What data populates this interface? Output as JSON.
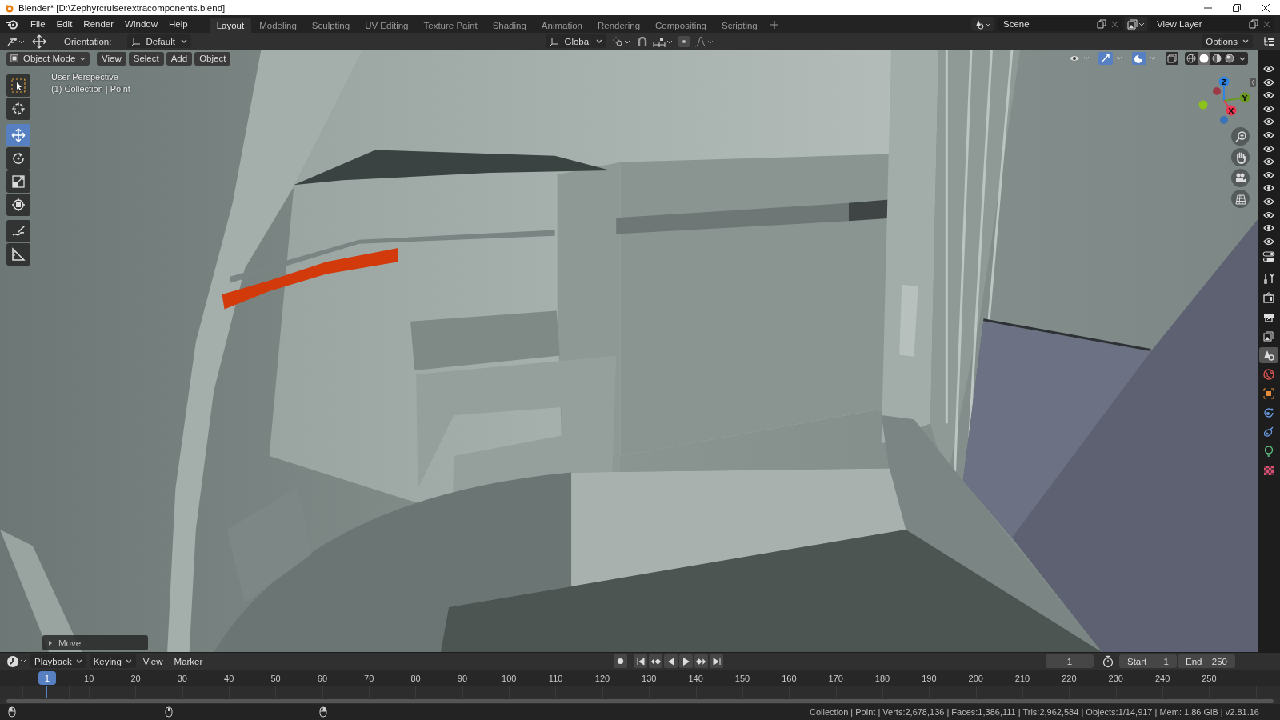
{
  "window": {
    "title": "Blender* [D:\\Zephyrcruiserextracomponents.blend]"
  },
  "menu": [
    "File",
    "Edit",
    "Render",
    "Window",
    "Help"
  ],
  "workspaces": [
    {
      "label": "Layout",
      "selected": true
    },
    {
      "label": "Modeling",
      "selected": false
    },
    {
      "label": "Sculpting",
      "selected": false
    },
    {
      "label": "UV Editing",
      "selected": false
    },
    {
      "label": "Texture Paint",
      "selected": false
    },
    {
      "label": "Shading",
      "selected": false
    },
    {
      "label": "Animation",
      "selected": false
    },
    {
      "label": "Rendering",
      "selected": false
    },
    {
      "label": "Compositing",
      "selected": false
    },
    {
      "label": "Scripting",
      "selected": false
    }
  ],
  "scene": "Scene",
  "view_layer": "View Layer",
  "tool_header": {
    "orientation_label": "Orientation:",
    "orientation": "Default",
    "transform_orientation": "Global",
    "options": "Options"
  },
  "viewport_header": {
    "mode": "Object Mode",
    "menus": [
      "View",
      "Select",
      "Add",
      "Object"
    ],
    "shading": [
      {
        "kind": "wireframe",
        "selected": false
      },
      {
        "kind": "solid",
        "selected": true
      },
      {
        "kind": "material",
        "selected": false
      },
      {
        "kind": "rendered",
        "selected": false
      }
    ]
  },
  "toolbar_groups": [
    [
      {
        "kind": "select",
        "selected": false
      },
      {
        "kind": "cursor",
        "selected": false
      }
    ],
    [
      {
        "kind": "move",
        "selected": true
      },
      {
        "kind": "rotate",
        "selected": false
      },
      {
        "kind": "scale",
        "selected": false
      },
      {
        "kind": "transform",
        "selected": false
      }
    ],
    [
      {
        "kind": "annotate",
        "selected": false
      },
      {
        "kind": "measure",
        "selected": false
      }
    ]
  ],
  "viewport": {
    "view_name": "User Perspective",
    "collection_info": "(1) Collection | Point",
    "last_operator": "Move",
    "gizmo_axes": [
      {
        "label": "Z",
        "color": "#2f83e3"
      },
      {
        "label": "Y",
        "color": "#6a9a1f"
      },
      {
        "label": "X",
        "color": "#f0334f"
      }
    ]
  },
  "properties_tabs": [
    {
      "kind": "tool",
      "selected": false
    },
    {
      "kind": "render",
      "selected": false
    },
    {
      "kind": "output",
      "selected": false
    },
    {
      "kind": "view_layer",
      "selected": false
    },
    {
      "kind": "scene",
      "selected": true
    },
    {
      "kind": "world",
      "selected": false
    },
    {
      "kind": "object",
      "selected": false
    },
    {
      "kind": "physics",
      "selected": false
    },
    {
      "kind": "constraints",
      "selected": false
    },
    {
      "kind": "light",
      "selected": false
    },
    {
      "kind": "texture",
      "selected": false
    }
  ],
  "timeline": {
    "menus": [
      {
        "label": "Playback",
        "dropdown": true
      },
      {
        "label": "Keying",
        "dropdown": true
      },
      {
        "label": "View",
        "dropdown": false
      },
      {
        "label": "Marker",
        "dropdown": false
      }
    ],
    "current_frame": "1",
    "start_label": "Start",
    "start": "1",
    "end_label": "End",
    "end": "250",
    "ruler_current": "1",
    "ruler_ticks": [
      "10",
      "20",
      "30",
      "40",
      "50",
      "60",
      "70",
      "80",
      "90",
      "100",
      "110",
      "120",
      "130",
      "140",
      "150",
      "160",
      "170",
      "180",
      "190",
      "200",
      "210",
      "220",
      "230",
      "240",
      "250"
    ]
  },
  "status": "Collection | Point | Verts:2,678,136 | Faces:1,386,111 | Tris:2,962,584 | Objects:1/14,917 | Mem: 1.86 GiB | v2.81.16"
}
